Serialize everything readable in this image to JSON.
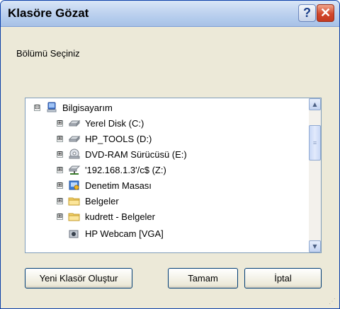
{
  "window": {
    "title": "Klasöre Gözat",
    "help_label": "?",
    "close_label": "✕"
  },
  "prompt": "Bölümü Seçiniz",
  "tree": {
    "items": [
      {
        "label": "Bilgisayarım",
        "expander": "⊟",
        "icon": "computer-icon",
        "level": 0
      },
      {
        "label": "Yerel Disk (C:)",
        "expander": "⊞",
        "icon": "hard-drive-icon",
        "level": 1
      },
      {
        "label": "HP_TOOLS (D:)",
        "expander": "⊞",
        "icon": "hard-drive-icon",
        "level": 1
      },
      {
        "label": "DVD-RAM Sürücüsü (E:)",
        "expander": "⊞",
        "icon": "dvd-drive-icon",
        "level": 1
      },
      {
        "label": "'192.168.1.3'/c$ (Z:)",
        "expander": "⊞",
        "icon": "network-drive-icon",
        "level": 1
      },
      {
        "label": "Denetim Masası",
        "expander": "⊞",
        "icon": "control-panel-icon",
        "level": 1
      },
      {
        "label": "Belgeler",
        "expander": "⊞",
        "icon": "folder-icon",
        "level": 1
      },
      {
        "label": "kudrett - Belgeler",
        "expander": "⊞",
        "icon": "folder-icon",
        "level": 1
      },
      {
        "label": "HP Webcam [VGA]",
        "expander": "",
        "icon": "webcam-icon",
        "level": 1
      }
    ]
  },
  "buttons": {
    "new_folder": "Yeni Klasör Oluştur",
    "ok": "Tamam",
    "cancel": "İptal"
  },
  "colors": {
    "title_text": "#000000",
    "dialog_bg": "#ece9d8",
    "close_button": "#d2462b"
  }
}
